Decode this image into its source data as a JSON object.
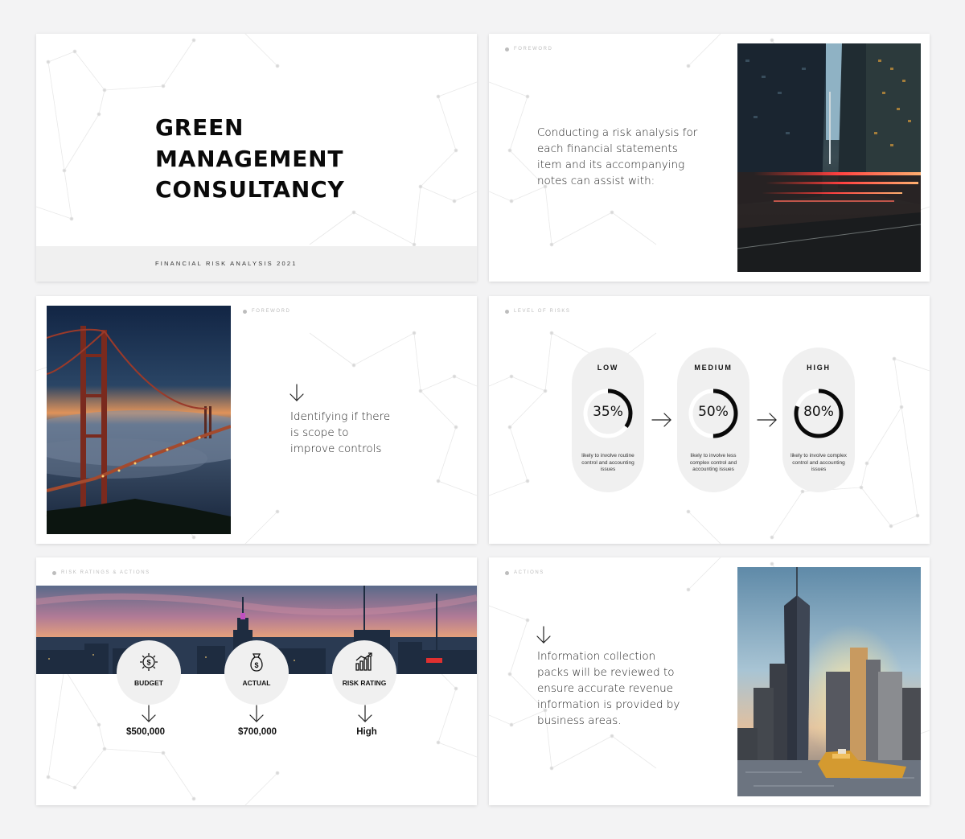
{
  "slide1": {
    "title_lines": [
      "GREEN",
      "MANAGEMENT",
      "CONSULTANCY"
    ],
    "footer": "FINANCIAL RISK ANALYSIS 2021"
  },
  "slide2": {
    "label": "FOREWORD",
    "text": "Conducting a risk analysis for each financial statements item and its accompanying notes can assist with:"
  },
  "slide3": {
    "label": "FOREWORD",
    "text": "Identifying if there is scope to improve controls"
  },
  "slide4": {
    "label": "LEVEL OF RISKS",
    "levels": [
      {
        "title": "LOW",
        "percent": 35,
        "value_text": "35%",
        "description": "likely to involve routine control and accounting issues"
      },
      {
        "title": "MEDIUM",
        "percent": 50,
        "value_text": "50%",
        "description": "likely to involve less complex control and accounting issues"
      },
      {
        "title": "HIGH",
        "percent": 80,
        "value_text": "80%",
        "description": "likely to involve complex control and accounting issues"
      }
    ]
  },
  "slide5": {
    "label": "RISK RATINGS & ACTIONS",
    "items": [
      {
        "label": "BUDGET",
        "value": "$500,000",
        "icon": "gear-dollar-icon"
      },
      {
        "label": "ACTUAL",
        "value": "$700,000",
        "icon": "money-bag-icon"
      },
      {
        "label": "RISK RATING",
        "value": "High",
        "icon": "bar-chart-icon"
      }
    ]
  },
  "slide6": {
    "label": "ACTIONS",
    "text": "Information collection packs will be reviewed to ensure accurate revenue information is provided by business areas."
  }
}
